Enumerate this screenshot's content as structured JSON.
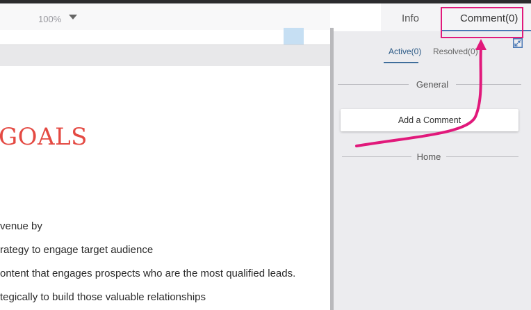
{
  "toolbar": {
    "zoom": "100%"
  },
  "document": {
    "heading": "GOALS",
    "lines": [
      "venue by",
      "rategy to engage target audience",
      "ontent that engages prospects who are the most qualified leads.",
      "tegically to build those valuable relationships"
    ]
  },
  "panel_tabs": {
    "info": "Info",
    "comment": "Comment(0)"
  },
  "comments": {
    "active": "Active(0)",
    "resolved": "Resolved(0)",
    "sections": [
      "General",
      "Home"
    ],
    "add_button": "Add a Comment"
  },
  "colors": {
    "heading": "#e44a43",
    "annotation": "#e1197b",
    "tab_accent": "#4a78b5"
  },
  "icons": {
    "zoom_dropdown": "chevron-down-icon",
    "collapse": "collapse-icon"
  }
}
